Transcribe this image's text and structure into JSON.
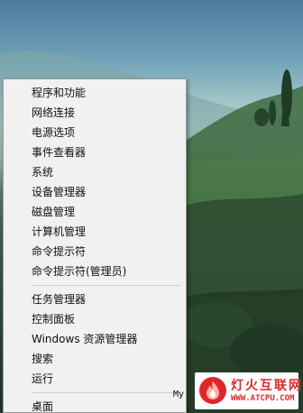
{
  "context_menu": {
    "group1": [
      {
        "label": "程序和功能",
        "name": "menu-item-programs-features"
      },
      {
        "label": "网络连接",
        "name": "menu-item-network-connections"
      },
      {
        "label": "电源选项",
        "name": "menu-item-power-options"
      },
      {
        "label": "事件查看器",
        "name": "menu-item-event-viewer"
      },
      {
        "label": "系统",
        "name": "menu-item-system"
      },
      {
        "label": "设备管理器",
        "name": "menu-item-device-manager"
      },
      {
        "label": "磁盘管理",
        "name": "menu-item-disk-management"
      },
      {
        "label": "计算机管理",
        "name": "menu-item-computer-management"
      },
      {
        "label": "命令提示符",
        "name": "menu-item-command-prompt"
      },
      {
        "label": "命令提示符(管理员)",
        "name": "menu-item-command-prompt-admin"
      }
    ],
    "group2": [
      {
        "label": "任务管理器",
        "name": "menu-item-task-manager"
      },
      {
        "label": "控制面板",
        "name": "menu-item-control-panel"
      },
      {
        "label": "Windows 资源管理器",
        "name": "menu-item-windows-explorer"
      },
      {
        "label": "搜索",
        "name": "menu-item-search"
      },
      {
        "label": "运行",
        "name": "menu-item-run"
      }
    ],
    "group3": [
      {
        "label": "桌面",
        "name": "menu-item-desktop"
      }
    ]
  },
  "desktop": {
    "partial_text": "My"
  },
  "watermark": {
    "title": "灯火互联网",
    "url": "WWW.ATCPU.COM",
    "logo_icon": "flame-logo-icon",
    "brand_color": "#e0262b"
  }
}
